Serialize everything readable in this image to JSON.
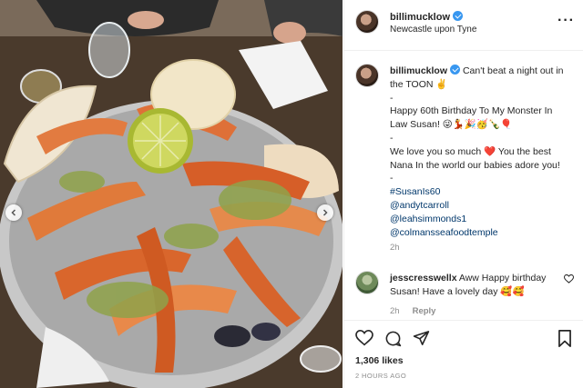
{
  "post": {
    "username": "billimucklow",
    "location": "Newcastle upon Tyne",
    "more_icon": "more-options-icon"
  },
  "caption": {
    "username": "billimucklow",
    "lines": [
      "Can't beat a night out in",
      "the TOON ✌️",
      "-",
      "Happy 60th Birthday To My Monster In",
      "Law Susan! 😜💃🎉🥳🍾🎈",
      "-",
      "We love you so much ❤️ You the best",
      "Nana In the world our babies adore you!",
      "-"
    ],
    "tags": [
      "#SusanIs60",
      "@andytcarroll",
      "@leahsimmonds1",
      "@colmansseafoodtemple"
    ],
    "time": "2h"
  },
  "comment": {
    "username": "jesscresswellx",
    "text_line1": "Aww Happy birthday",
    "text_line2": "Susan! Have a lovely day 🥰🥰",
    "time": "2h",
    "reply": "Reply"
  },
  "actions": {
    "likes": "1,306 likes",
    "timestamp": "2 HOURS AGO"
  },
  "icons": {
    "like": "heart-icon",
    "comment": "comment-icon",
    "share": "share-icon",
    "save": "bookmark-icon",
    "prev": "chevron-left-icon",
    "next": "chevron-right-icon"
  },
  "colors": {
    "verified": "#3897f0",
    "link": "#00376b",
    "muted": "#8e8e8e"
  }
}
